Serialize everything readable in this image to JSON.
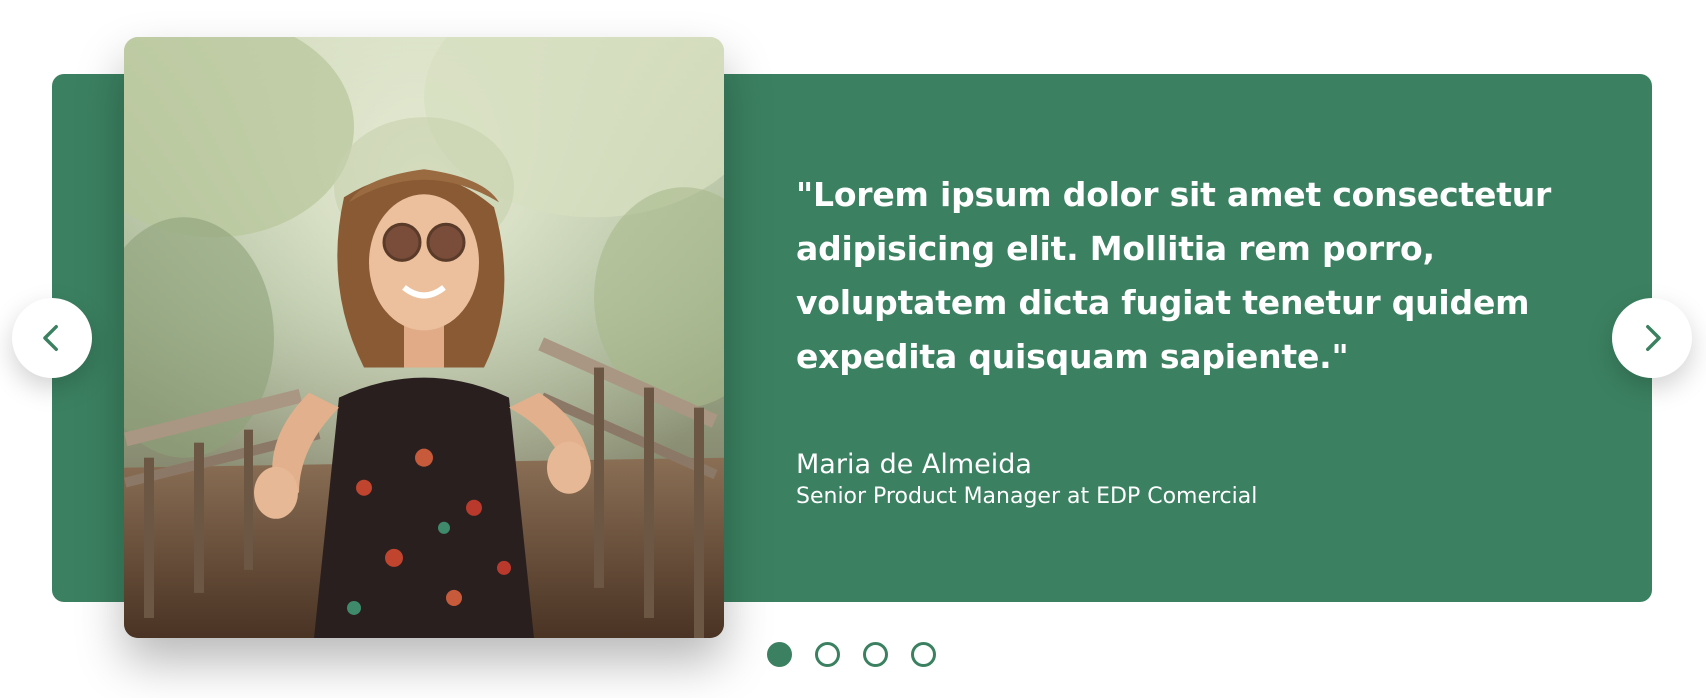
{
  "testimonial": {
    "quote": "\"Lorem ipsum dolor sit amet consectetur adipisicing elit. Mollitia rem porro, voluptatem dicta fugiat tenetur quidem expedita quisquam sapiente.\"",
    "author": "Maria de Almeida",
    "role": "Senior Product Manager at EDP Comercial",
    "photo_alt": "Smiling woman with sunglasses making peace signs on a wooden bridge"
  },
  "navigation": {
    "prev_icon": "chevron-left-icon",
    "next_icon": "chevron-right-icon"
  },
  "pagination": {
    "total": 4,
    "active_index": 0
  },
  "colors": {
    "accent": "#3b8161",
    "text_on_accent": "#ffffff",
    "button_bg": "#ffffff"
  }
}
